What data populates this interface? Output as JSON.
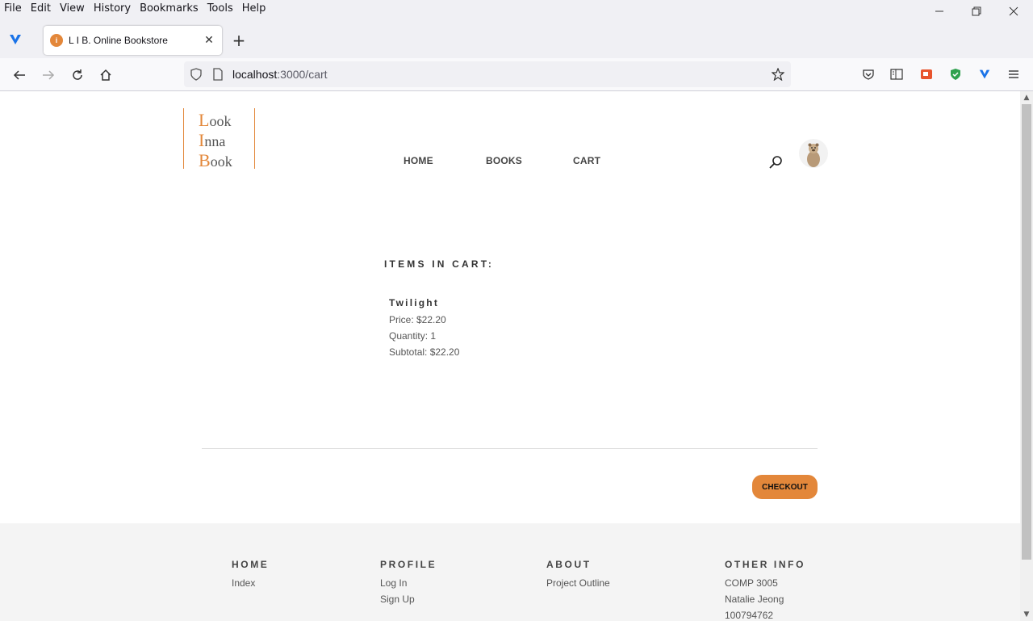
{
  "browser": {
    "menu": [
      "File",
      "Edit",
      "View",
      "History",
      "Bookmarks",
      "Tools",
      "Help"
    ],
    "tab_title": "L I B. Online Bookstore",
    "favicon_text": "i",
    "url_host": "localhost",
    "url_path": ":3000/cart"
  },
  "site": {
    "logo": {
      "line1_cap": "L",
      "line1_rest": "ook",
      "line2_cap": "I",
      "line2_rest": "nna",
      "line3_cap": "B",
      "line3_rest": "ook"
    },
    "nav": {
      "home": "HOME",
      "books": "BOOKS",
      "cart": "CART"
    }
  },
  "cart": {
    "heading": "ITEMS IN CART:",
    "items": [
      {
        "title": "Twilight",
        "price": "Price: $22.20",
        "quantity": "Quantity: 1",
        "subtotal": "Subtotal: $22.20"
      }
    ],
    "checkout_label": "CHECKOUT"
  },
  "footer": {
    "home": {
      "heading": "HOME",
      "links": [
        "Index"
      ]
    },
    "profile": {
      "heading": "PROFILE",
      "links": [
        "Log In",
        "Sign Up"
      ]
    },
    "about": {
      "heading": "ABOUT",
      "links": [
        "Project Outline"
      ]
    },
    "other": {
      "heading": "OTHER INFO",
      "lines": [
        "COMP 3005",
        "Natalie Jeong",
        "100794762"
      ]
    }
  },
  "colors": {
    "accent": "#e3873a"
  }
}
